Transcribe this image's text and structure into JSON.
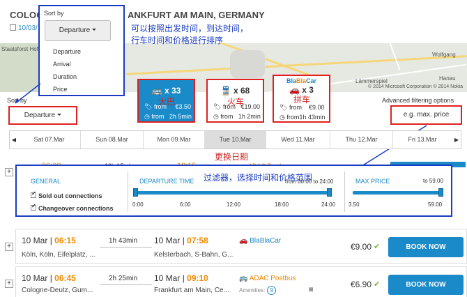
{
  "header": {
    "title_left": "COLOG",
    "title_right": "ANKFURT AM MAIN, GERMANY",
    "date_partial": "10/03/"
  },
  "map": {
    "labels": [
      "Staatsforst Hofheim",
      "Wolfgang",
      "Lämmerspiel",
      "Hanau"
    ],
    "copyright": "© 2014 Microsoft Corporation © 2014 Nokia"
  },
  "sort_popup": {
    "label": "Sort by",
    "selected": "Departure",
    "options": [
      "Departure",
      "Arrival",
      "Duration",
      "Price"
    ]
  },
  "annotations": {
    "sort_note_line1": "可以按照出发时间，到达时间，",
    "sort_note_line2": "行车时间和价格进行排序",
    "bus_cn": "大巴",
    "train_cn": "火车",
    "car_cn": "拼车",
    "date_cn": "更换日期",
    "filter_cn": "过滤器，选择时间和价格范围"
  },
  "sort": {
    "label": "Sort by",
    "selected": "Departure"
  },
  "modes": [
    {
      "icon": "bus-icon",
      "count": "x 33",
      "from_price": "€3.50",
      "from_time": "2h 5min",
      "active": true
    },
    {
      "icon": "train-icon",
      "count": "x 68",
      "from_price": "€19.00",
      "from_time": "1h 2min",
      "active": false
    },
    {
      "icon": "car-icon",
      "brand": "BlaBlaCar",
      "count": "x 3",
      "from_price": "€9.00",
      "from_time": "1h 43min",
      "active": false
    }
  ],
  "from_label": "from",
  "advanced": {
    "label": "Advanced filtering options",
    "placeholder": "e.g. max. price"
  },
  "dates": [
    {
      "label": "Sat 07.Mar",
      "selected": false
    },
    {
      "label": "Sun 08.Mar",
      "selected": false
    },
    {
      "label": "Mon 09.Mar",
      "selected": false
    },
    {
      "label": "Tue 10.Mar",
      "selected": true
    },
    {
      "label": "Wed 11.Mar",
      "selected": false
    },
    {
      "label": "Thu 12.Mar",
      "selected": false
    },
    {
      "label": "Fri 13.Mar",
      "selected": false
    }
  ],
  "filter": {
    "general": "GENERAL",
    "sold_out": "Sold out connections",
    "changeover": "Changeover connections",
    "departure_time": "DEPARTURE TIME",
    "departure_range": "from 00:00 to 24:00",
    "time_ticks": [
      "0:00",
      "6:00",
      "12:00",
      "18:00",
      "24:00"
    ],
    "max_price": "MAX PRICE",
    "max_price_value": "to 59.00",
    "price_min": "3.50",
    "price_max": "59.00"
  },
  "partial_row": {
    "dep": "06:00",
    "dur": "13h 15min",
    "arr": "18:15",
    "prov": "ADAC Postbus"
  },
  "results": [
    {
      "date": "10 Mar",
      "dep": "06:15",
      "dur": "1h 43min",
      "arr_date": "10 Mar",
      "arr": "07:58",
      "from": "Köln, Köln, Eifelplatz, ...",
      "to": "Kelsterbach, S-Bahn, G...",
      "provider": "BlaBlaCar",
      "price": "€9.00",
      "amenities": "",
      "amen_count": "",
      "book": "BOOK NOW"
    },
    {
      "date": "10 Mar",
      "dep": "06:45",
      "dur": "2h 25min",
      "arr_date": "10 Mar",
      "arr": "09:10",
      "from": "Cologne-Deutz, Gum...",
      "to": "Frankfurt am Main, Ce...",
      "provider": "ADAC Postbus",
      "price": "€6.90",
      "amenities": "Amenities:",
      "amen_count": "9",
      "book": "BOOK NOW"
    }
  ]
}
